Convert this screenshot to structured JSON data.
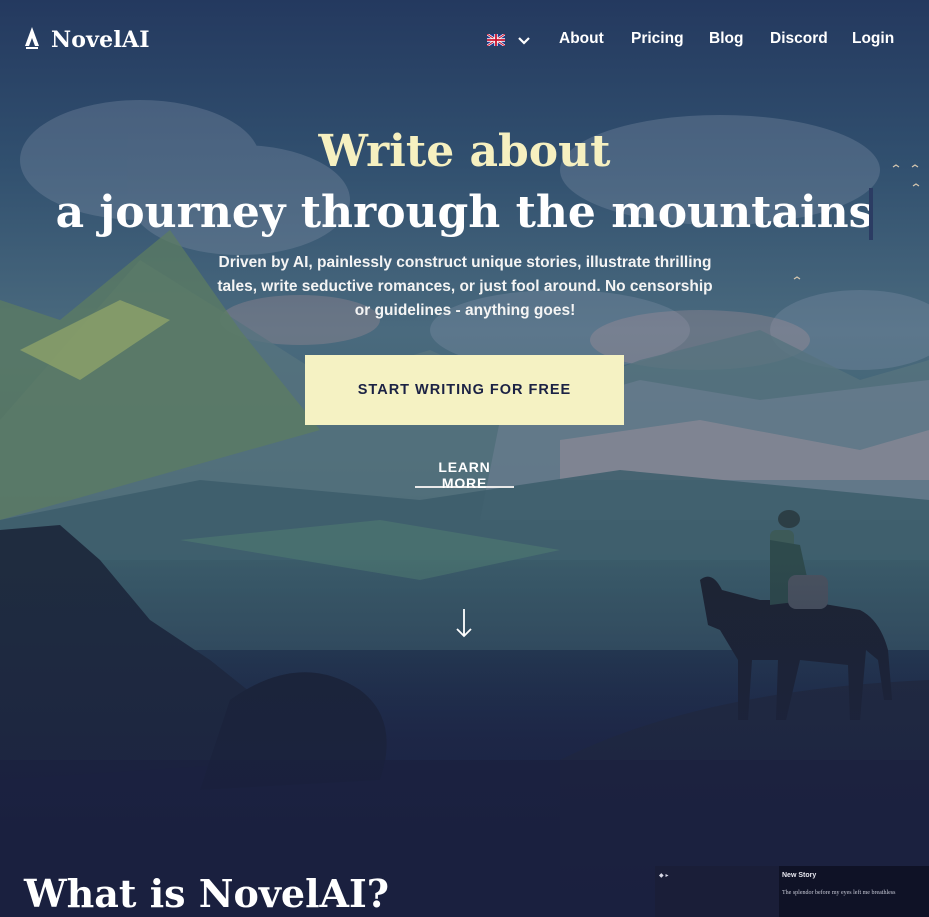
{
  "nav": {
    "brand": "NovelAI",
    "links": [
      "About",
      "Pricing",
      "Blog",
      "Discord",
      "Login"
    ]
  },
  "hero": {
    "headline_line1": "Write about",
    "headline_line2": "a journey through the mountains",
    "subtitle": "Driven by AI, painlessly construct unique stories, illustrate thrilling tales, write seductive romances, or just fool around. No censorship or guidelines - anything goes!",
    "cta_label": "START WRITING FOR FREE",
    "learn_more_label": "LEARN MORE"
  },
  "section": {
    "title": "What is NovelAI?"
  },
  "preview": {
    "doc_title": "New Story",
    "doc_text": "The splendor before my eyes left me breathless"
  },
  "colors": {
    "accent": "#f5f2c3",
    "headline_accent": "#f6f0c0",
    "background": "#1c2345"
  },
  "icons": {
    "logo": "quill-pen-icon",
    "language": "uk-flag-icon",
    "dropdown": "chevron-down-icon",
    "scroll": "arrow-down-icon"
  }
}
